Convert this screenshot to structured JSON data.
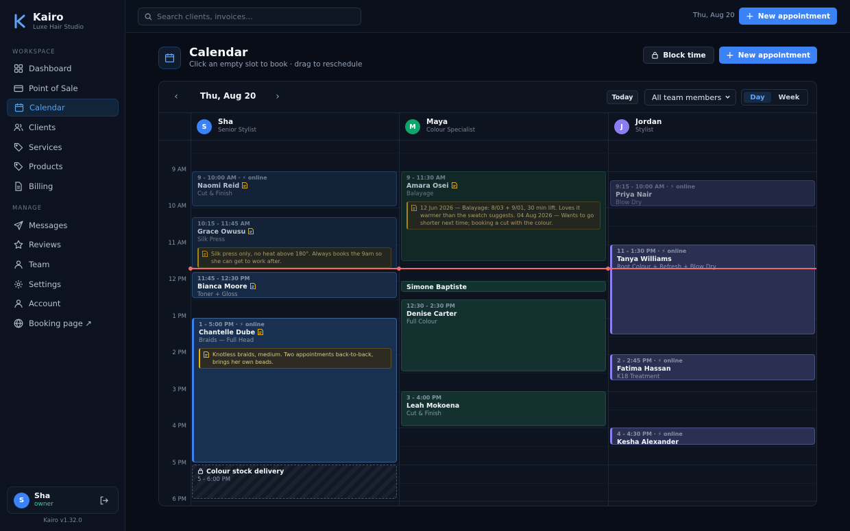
{
  "brand": {
    "name": "Kairo",
    "subtitle": "Luxe Hair Studio"
  },
  "sidebar": {
    "workspace_label": "WORKSPACE",
    "manage_label": "MANAGE",
    "workspace_items": [
      {
        "label": "Dashboard",
        "icon": "grid-icon"
      },
      {
        "label": "Point of Sale",
        "icon": "card-icon"
      },
      {
        "label": "Calendar",
        "icon": "calendar-icon",
        "active": true
      },
      {
        "label": "Clients",
        "icon": "users-icon"
      },
      {
        "label": "Services",
        "icon": "tag-icon"
      },
      {
        "label": "Products",
        "icon": "tag-icon"
      },
      {
        "label": "Billing",
        "icon": "file-icon"
      }
    ],
    "manage_items": [
      {
        "label": "Messages",
        "icon": "send-icon"
      },
      {
        "label": "Reviews",
        "icon": "star-icon"
      },
      {
        "label": "Team",
        "icon": "user-icon"
      },
      {
        "label": "Settings",
        "icon": "gear-icon"
      },
      {
        "label": "Account",
        "icon": "user-icon"
      },
      {
        "label": "Booking page ↗",
        "icon": "globe-icon"
      }
    ],
    "user": {
      "initial": "S",
      "name": "Sha",
      "role": "owner"
    },
    "version": "Kairo v1.32.0"
  },
  "topbar": {
    "search_placeholder": "Search clients, invoices...",
    "date": "Thu, Aug 20",
    "new_appointment": "New appointment"
  },
  "page": {
    "title": "Calendar",
    "subtitle": "Click an empty slot to book · drag to reschedule",
    "block_time": "Block time",
    "new_appointment": "New appointment"
  },
  "calendar": {
    "date": "Thu, Aug 20",
    "today": "Today",
    "team_filter": "All team members",
    "view_day": "Day",
    "view_week": "Week",
    "hours": [
      "9 AM",
      "10 AM",
      "11 AM",
      "12 PM",
      "1 PM",
      "2 PM",
      "3 PM",
      "4 PM",
      "5 PM",
      "6 PM"
    ],
    "staff": [
      {
        "initial": "S",
        "name": "Sha",
        "role": "Senior Stylist",
        "color": "#3b82f6"
      },
      {
        "initial": "M",
        "name": "Maya",
        "role": "Colour Specialist",
        "color": "#10a36b"
      },
      {
        "initial": "J",
        "name": "Jordan",
        "role": "Stylist",
        "color": "#8b7cf0"
      }
    ],
    "appointments": {
      "naomi": {
        "time": "9 - 10:00 AM · ⚡ online",
        "name": "Naomi Reid",
        "service": "Cut & Finish"
      },
      "grace": {
        "time": "10:15 - 11:45 AM",
        "name": "Grace Owusu",
        "service": "Silk Press",
        "note": "Silk press only, no heat above 180°. Always books the 9am so she can get to work after."
      },
      "bianca": {
        "time": "11:45 - 12:30 PM",
        "name": "Bianca Moore",
        "service": "Toner + Gloss"
      },
      "chantelle": {
        "time": "1 - 5:00 PM · ⚡ online",
        "name": "Chantelle Dube",
        "service": "Braids — Full Head",
        "note": "Knotless braids, medium. Two appointments back-to-back, brings her own beads."
      },
      "amara": {
        "time": "9 - 11:30 AM",
        "name": "Amara Osei",
        "service": "Balayage",
        "note": "12 Jun 2026 — Balayage: 8/03 + 9/01, 30 min lift. Loves it warmer than the swatch suggests. 04 Aug 2026 — Wants to go shorter next time; booking a cut with the colour."
      },
      "simone": {
        "name": "Simone Baptiste"
      },
      "denise": {
        "time": "12:30 - 2:30 PM",
        "name": "Denise Carter",
        "service": "Full Colour"
      },
      "leah": {
        "time": "3 - 4:00 PM",
        "name": "Leah Mokoena",
        "service": "Cut & Finish"
      },
      "priya": {
        "time": "9:15 - 10:00 AM · ⚡ online",
        "name": "Priya Nair",
        "service": "Blow Dry"
      },
      "tanya": {
        "time": "11 - 1:30 PM · ⚡ online",
        "name": "Tanya Williams",
        "service": "Root Colour + Refresh + Blow Dry"
      },
      "fatima": {
        "time": "2 - 2:45 PM · ⚡ online",
        "name": "Fatima Hassan",
        "service": "K18 Treatment"
      },
      "kesha": {
        "time": "4 - 4:30 PM · ⚡ online",
        "name": "Kesha Alexander"
      }
    },
    "block": {
      "title": "Colour stock delivery",
      "time": "5 - 6:00 PM"
    }
  },
  "colors": {
    "accent": "#3b82f6",
    "now_line": "#ef6b6b",
    "note": "#eab308"
  }
}
